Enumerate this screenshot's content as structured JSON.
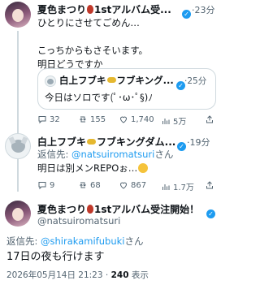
{
  "tweet1": {
    "display_name": "夏色まつり",
    "name_suffix": "1stアルバム受...",
    "time": "23分",
    "lines": [
      "ひとりにさせてごめん…",
      "",
      "こっちからもさそいます。",
      "明日どうですか"
    ],
    "quote": {
      "display_name": "白上フブキ",
      "name_suffix": "フブキング...",
      "time": "25分",
      "text": "今日はソロです(ﾟ･ω･ﾟ§)ﾉ"
    },
    "actions": {
      "replies": "32",
      "retweets": "155",
      "likes": "1,740",
      "views": "5万"
    }
  },
  "tweet2": {
    "display_name": "白上フブキ",
    "name_suffix": "フブキングダム...",
    "time": "19分",
    "reply_prefix": "返信先: ",
    "reply_handle": "@natsuiromatsuri",
    "reply_suffix": "さん",
    "text": "明日は別メンREPOぉ…",
    "actions": {
      "replies": "9",
      "retweets": "68",
      "likes": "867",
      "views": "1.7万"
    }
  },
  "tweet3": {
    "display_name": "夏色まつり",
    "name_suffix": "1stアルバム受注開始！",
    "handle": "@natsuiromatsuri",
    "reply_prefix": "返信先: ",
    "reply_handle": "@shirakamifubuki",
    "reply_suffix": "さん",
    "text": "17日の夜も行けます",
    "timestamp": "2026年05月14日 21:23",
    "views_count": "240",
    "views_label": "表示"
  },
  "colors": {
    "accent": "#1d9bf0",
    "secondary_text": "#536471",
    "border": "#cfd9de"
  }
}
